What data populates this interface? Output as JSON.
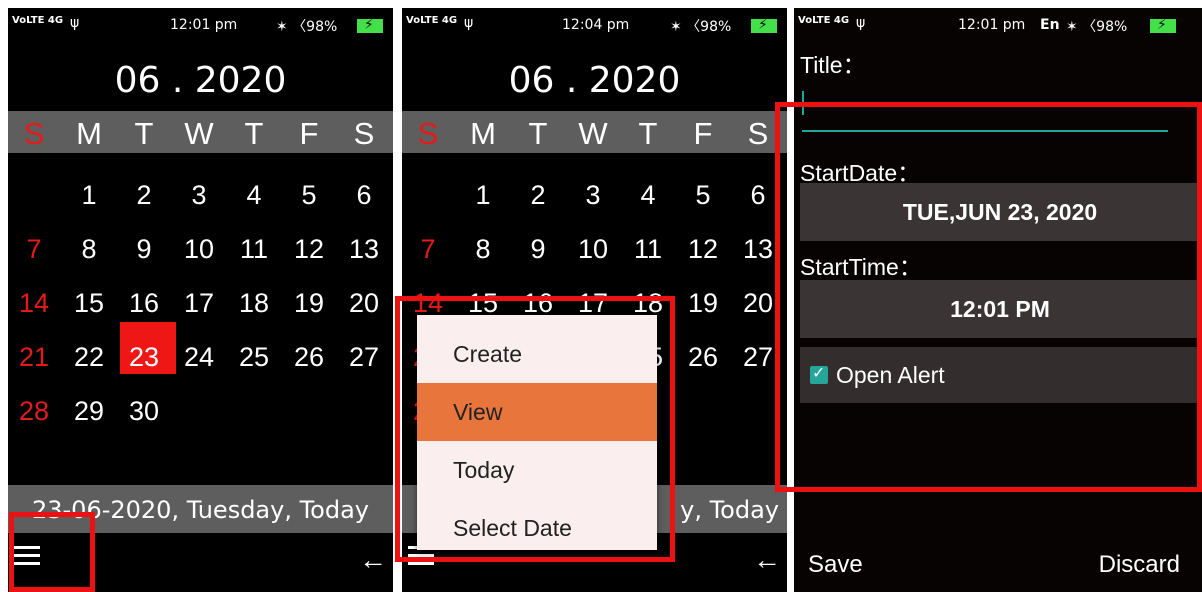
{
  "status_bar": {
    "network_label": "VoLTE 4G",
    "usb_icon": "ψ",
    "signal_text": "✶ 〈98%",
    "time_s1": "12:01 pm",
    "time_s2": "12:04 pm",
    "time_s3": "12:01 pm",
    "lang_s3": "En",
    "battery_icon": "⚡"
  },
  "calendar": {
    "month_label": "06 . 2020",
    "weekdays": [
      "S",
      "M",
      "T",
      "W",
      "T",
      "F",
      "S"
    ],
    "weeks": [
      [
        "",
        "1",
        "2",
        "3",
        "4",
        "5",
        "6"
      ],
      [
        "7",
        "8",
        "9",
        "10",
        "11",
        "12",
        "13"
      ],
      [
        "14",
        "15",
        "16",
        "17",
        "18",
        "19",
        "20"
      ],
      [
        "21",
        "22",
        "23",
        "24",
        "25",
        "26",
        "27"
      ],
      [
        "28",
        "29",
        "30",
        "",
        "",
        "",
        ""
      ]
    ],
    "selected_day": "23",
    "footer_text": "23-06-2020, Tuesday, Today",
    "footer_partial": "y, Today",
    "back_icon": "←"
  },
  "menu": {
    "items": [
      "Create",
      "View",
      "Today",
      "Select Date"
    ],
    "highlighted": "View",
    "highlight_color": "#e8763c"
  },
  "event_form": {
    "title_label": "Title：",
    "start_date_label": "StartDate：",
    "start_date_value": "TUE,JUN 23, 2020",
    "start_time_label": "StartTime：",
    "start_time_value": "12:01 PM",
    "open_alert_label": "Open Alert",
    "open_alert_checked": true,
    "save_label": "Save",
    "discard_label": "Discard"
  },
  "colors": {
    "highlight_box": "#ee1111",
    "sunday_red": "#e51b1b",
    "selected_day_bg": "#ef1616",
    "accent_teal": "#26a69a"
  }
}
